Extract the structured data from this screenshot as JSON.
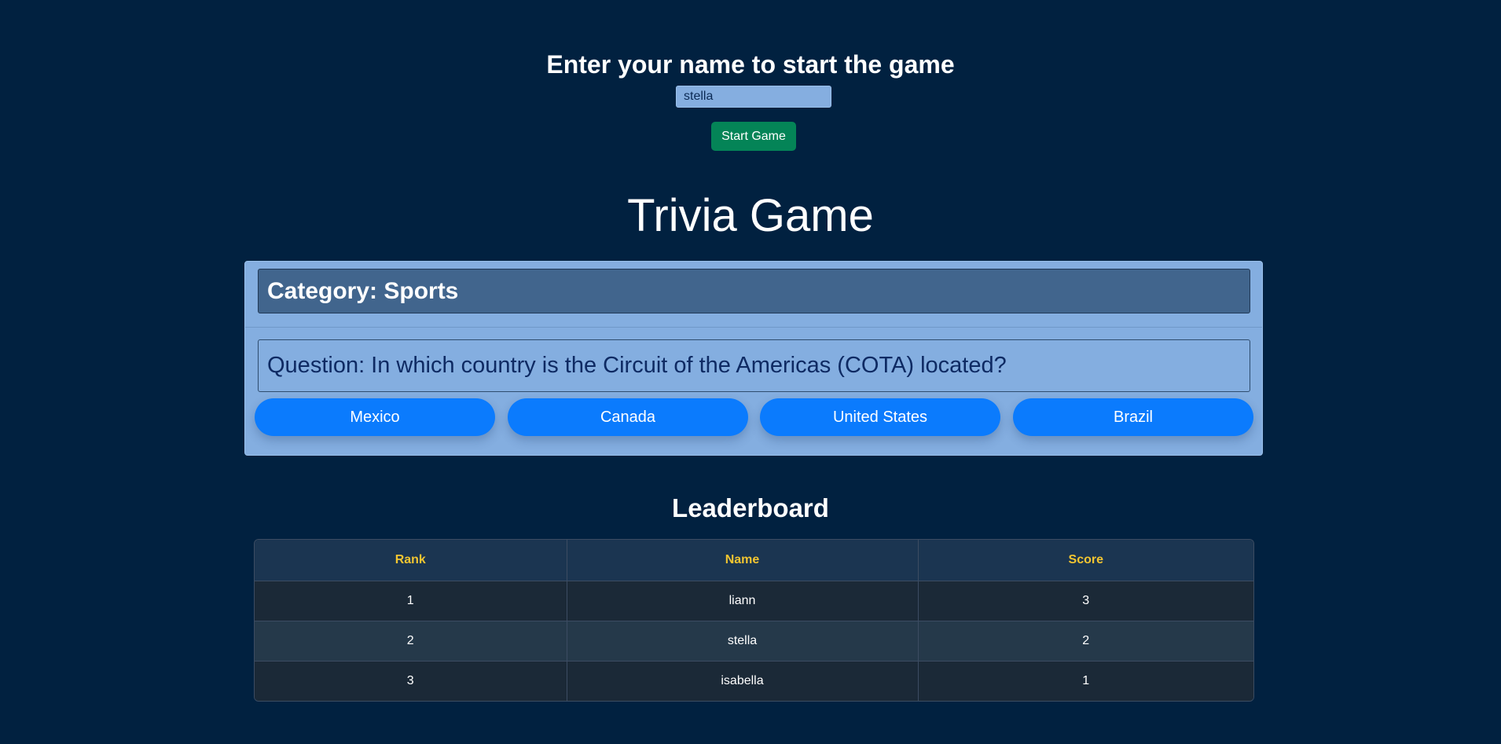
{
  "login": {
    "heading": "Enter your name to start the game",
    "name_value": "stella",
    "start_label": "Start Game"
  },
  "game": {
    "title": "Trivia Game",
    "category": "Category: Sports",
    "question": "Question: In which country is the Circuit of the Americas (COTA) located?",
    "answers": [
      "Mexico",
      "Canada",
      "United States",
      "Brazil"
    ]
  },
  "leaderboard": {
    "title": "Leaderboard",
    "columns": [
      "Rank",
      "Name",
      "Score"
    ],
    "rows": [
      [
        "1",
        "liann",
        "3"
      ],
      [
        "2",
        "stella",
        "2"
      ],
      [
        "3",
        "isabella",
        "1"
      ]
    ]
  },
  "colors": {
    "background": "#012140",
    "start_button": "#048457",
    "answer_button": "#0b7bfd",
    "header_text": "#f2c531"
  }
}
